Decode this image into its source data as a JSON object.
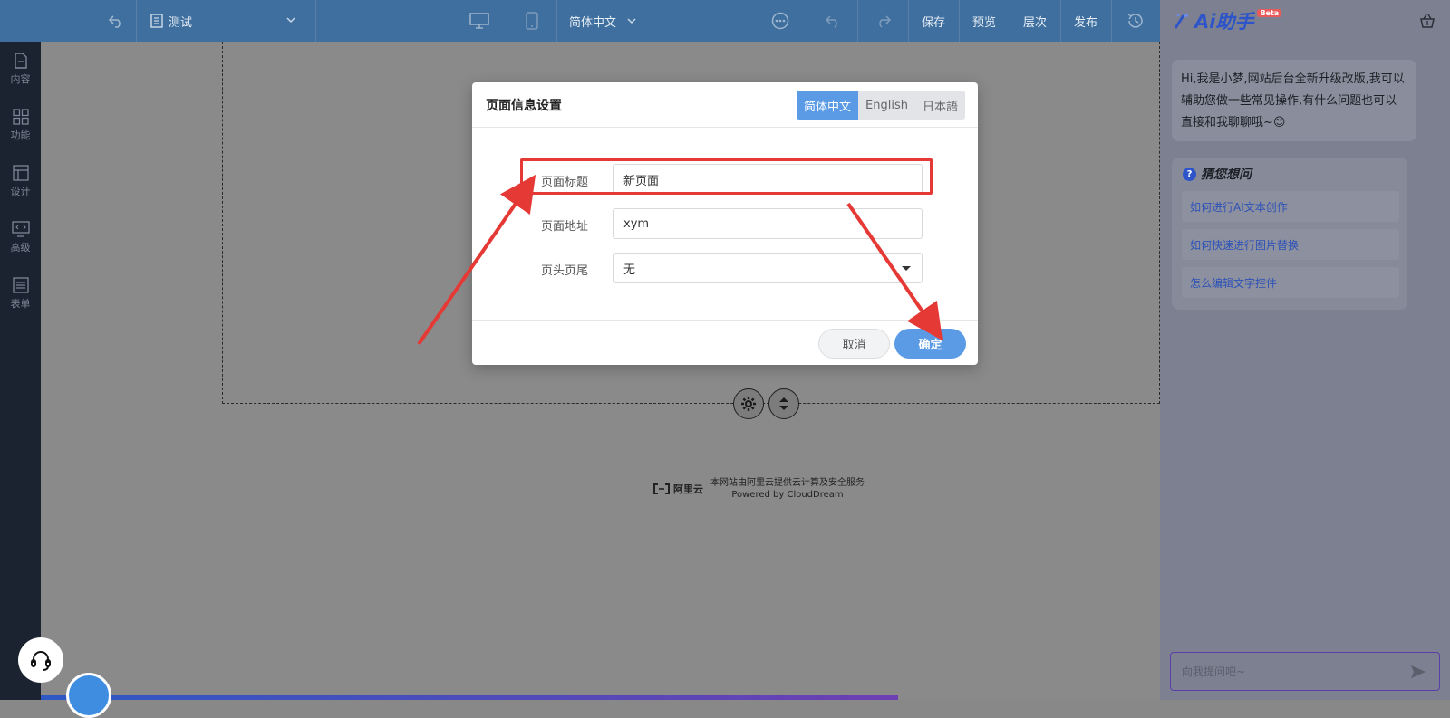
{
  "topbar": {
    "page_select": "测试",
    "language_select": "简体中文",
    "save": "保存",
    "preview": "预览",
    "layers": "层次",
    "publish": "发布"
  },
  "sidebar": {
    "items": [
      {
        "label": "内容"
      },
      {
        "label": "功能"
      },
      {
        "label": "设计"
      },
      {
        "label": "高级"
      },
      {
        "label": "表单"
      }
    ]
  },
  "footer": {
    "provider_logo": "阿里云",
    "provider_text": "本网站由阿里云提供云计算及安全服务",
    "powered": "Powered by CloudDream"
  },
  "modal": {
    "title": "页面信息设置",
    "lang_tabs": [
      "简体中文",
      "English",
      "日本語"
    ],
    "active_lang": "简体中文",
    "fields": {
      "title_label": "页面标题",
      "title_value": "新页面",
      "url_label": "页面地址",
      "url_value": "xym",
      "header_footer_label": "页头页尾",
      "header_footer_value": "无"
    },
    "cancel": "取消",
    "ok": "确定"
  },
  "ai": {
    "logo": "Ai助手",
    "beta": "Beta",
    "greeting": "Hi,我是小梦,网站后台全新升级改版,我可以辅助您做一些常见操作,有什么问题也可以直接和我聊聊哦~😊",
    "guess_title": "猜您想问",
    "questions": [
      "如何进行AI文本创作",
      "如何快速进行图片替换",
      "怎么编辑文字控件"
    ],
    "input_placeholder": "向我提问吧~"
  },
  "colors": {
    "topbar": "#3f6f9e",
    "sidebar": "#1b2230",
    "primary": "#5b9be6",
    "highlight": "#e53935",
    "arrow": "#e53935",
    "ai_brand": "#2d55c9"
  }
}
